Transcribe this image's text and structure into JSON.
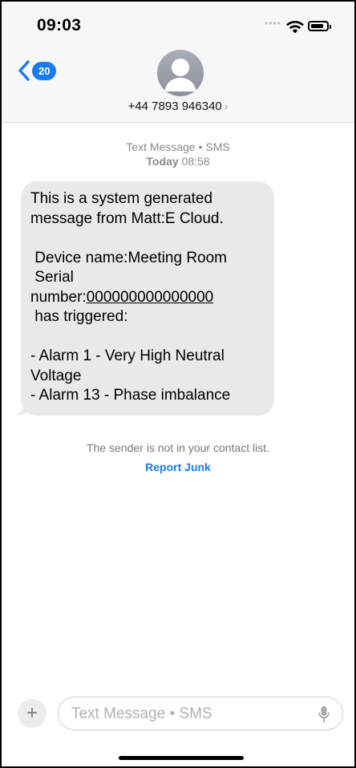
{
  "status_bar": {
    "time": "09:03"
  },
  "header": {
    "back_badge": "20",
    "contact_number": "+44 7893 946340",
    "contact_chevron": "›"
  },
  "thread": {
    "meta_type": "Text Message • SMS",
    "meta_time_day": "Today",
    "meta_time_clock": "08:58",
    "message_lines": [
      "This is a system generated",
      "message from Matt:E Cloud.",
      "",
      " Device name:Meeting Room",
      " Serial"
    ],
    "serial_prefix": "number:",
    "serial_value": "000000000000000",
    "message_lines_after": [
      " has triggered:",
      "",
      "- Alarm 1 - Very High Neutral",
      "Voltage",
      "- Alarm 13 - Phase imbalance"
    ],
    "not_in_contacts": "The sender is not in your contact list.",
    "report_junk": "Report Junk"
  },
  "compose": {
    "plus_label": "+",
    "placeholder": "Text Message • SMS"
  },
  "icons": {
    "back": "chevron-left-icon",
    "avatar": "person-icon",
    "mic": "microphone-icon",
    "wifi": "wifi-icon",
    "battery": "battery-icon"
  },
  "colors": {
    "accent": "#1a7cf5",
    "bubble": "#e9e9eb",
    "meta": "#8a8a8e"
  }
}
